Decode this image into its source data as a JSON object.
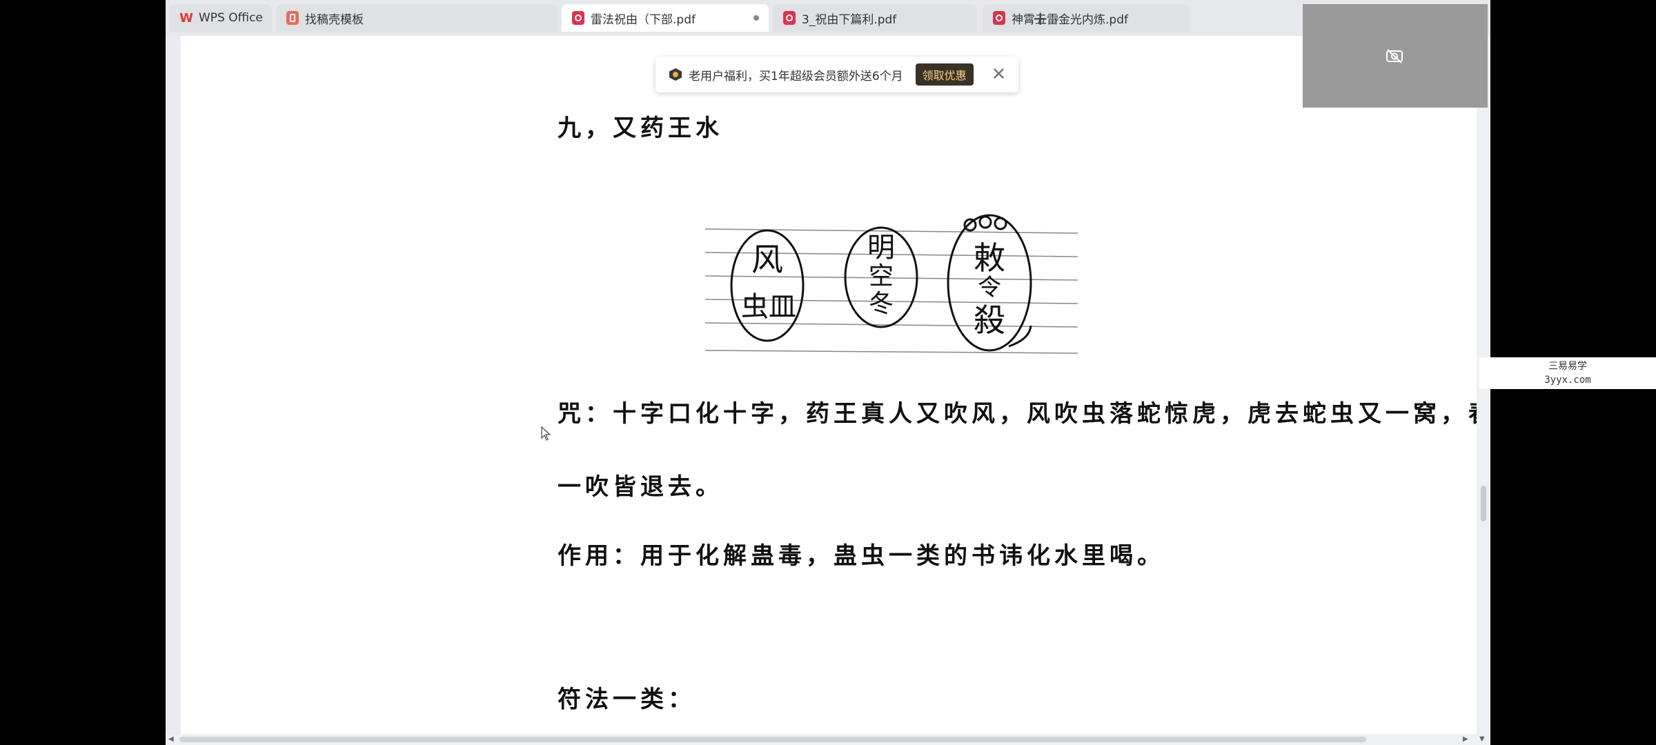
{
  "tabs": [
    {
      "label": "WPS Office",
      "icon": "wps-logo-icon",
      "active": false
    },
    {
      "label": "找稿壳模板",
      "icon": "template-icon",
      "active": false
    },
    {
      "label": "雷法祝由（下部.pdf",
      "icon": "pdf-icon",
      "active": true
    },
    {
      "label": "3_祝由下篇利.pdf",
      "icon": "pdf-icon",
      "active": false
    },
    {
      "label": "神霄五雷金光内炼.pdf",
      "icon": "pdf-icon",
      "active": false
    }
  ],
  "tabbar": {
    "new_tab": "+",
    "dropdown": "⌄"
  },
  "promo": {
    "text": "老用户福利，买1年超级会员额外送6个月",
    "button": "领取优惠",
    "close": "✕"
  },
  "document": {
    "heading": "九，又药王水",
    "talisman": {
      "left": [
        "风",
        "虫皿"
      ],
      "middle": [
        "明",
        "空",
        "冬"
      ],
      "right": [
        "敕",
        "令",
        "殺"
      ]
    },
    "mantra_line1": "咒：十字口化十字，药王真人又吹风，风吹虫落蛇惊虎，虎去蛇虫又一窝，春风",
    "mantra_line2": "一吹皆退去。",
    "usage": "作用：用于化解蛊毒，蛊虫一类的书讳化水里喝。",
    "section": "符法一类："
  },
  "watermark": {
    "line1": "三易易学",
    "line2": "3yyx.com"
  },
  "colors": {
    "pdf_red": "#d9344f",
    "promo_button_bg": "#3a3226",
    "promo_button_text": "#f5d28a"
  }
}
